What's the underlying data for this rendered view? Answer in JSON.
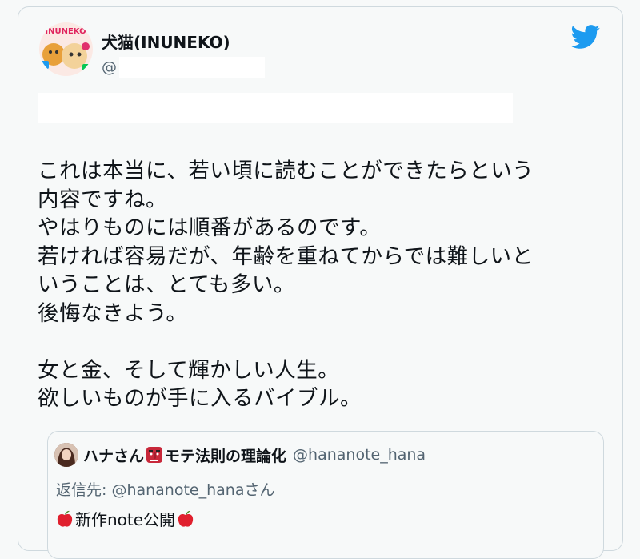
{
  "tweet": {
    "author_name": "犬猫(INUNEKO)",
    "handle_prefix": "@",
    "avatar_text": "INUNEKO",
    "text": "これは本当に、若い頃に読むことができたらという\n内容ですね。\nやはりものには順番があるのです。\n若ければ容易だが、年齢を重ねてからでは難しいと\nいうことは、とても多い。\n後悔なきよう。\n\n女と金、そして輝かしい人生。\n欲しいものが手に入るバイブル。"
  },
  "quoted_tweet": {
    "name_part1": "ハナさん",
    "name_part2": "モテ法則の理論化",
    "handle": "@hananote_hana",
    "reply_to": "返信先: @hananote_hanaさん",
    "body": "新作note公開"
  },
  "icons": {
    "brand": "twitter-bird-icon",
    "emoji_tengu": "tengu-mask-icon",
    "emoji_apple": "red-apple-icon"
  },
  "colors": {
    "twitter_blue": "#1d9bf0",
    "text_primary": "#0f1419",
    "text_secondary": "#536471",
    "border": "#cfd9de"
  }
}
